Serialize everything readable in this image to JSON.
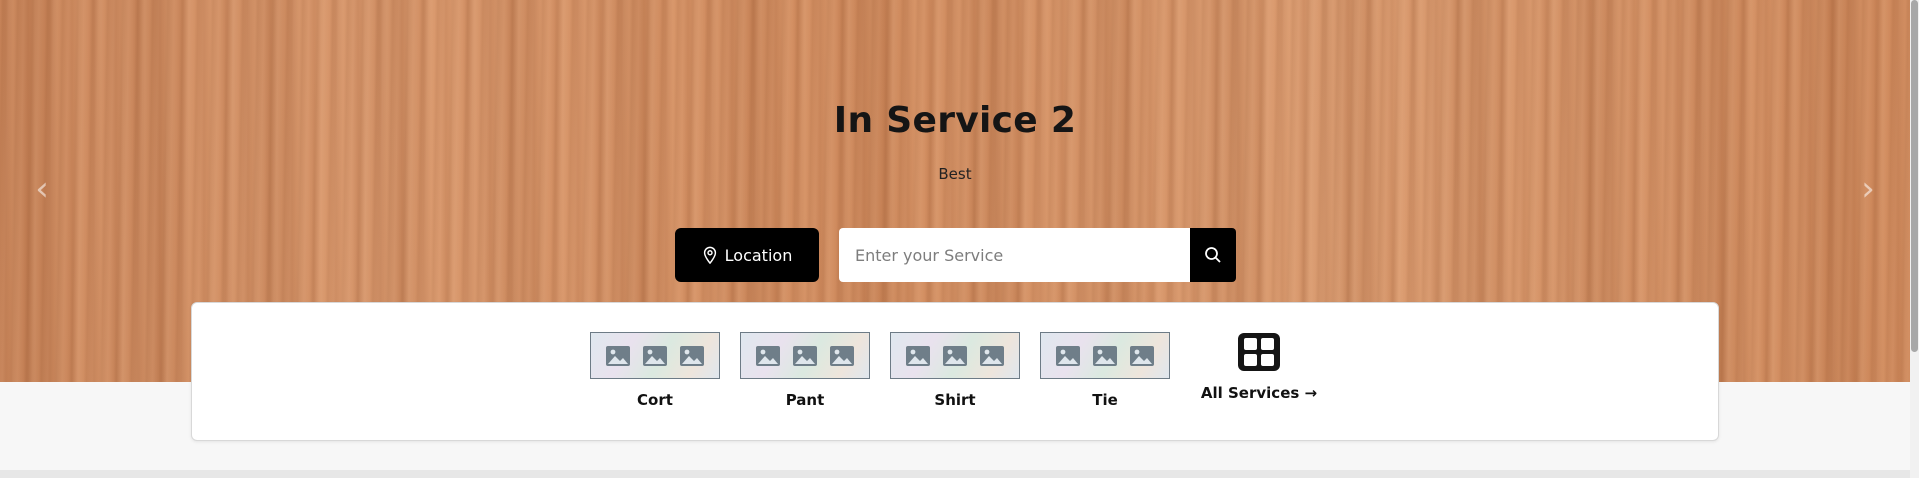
{
  "hero": {
    "title": "In Service 2",
    "subtitle": "Best",
    "prev_arrow": "‹",
    "next_arrow": "›"
  },
  "search": {
    "location_label": "Location",
    "location_icon": "map-pin-icon",
    "placeholder": "Enter your Service",
    "value": "",
    "search_icon": "search-icon"
  },
  "services": {
    "items": [
      {
        "label": "Cort",
        "icon": "image-placeholder-icon"
      },
      {
        "label": "Pant",
        "icon": "image-placeholder-icon"
      },
      {
        "label": "Shirt",
        "icon": "image-placeholder-icon"
      },
      {
        "label": "Tie",
        "icon": "image-placeholder-icon"
      }
    ],
    "all_label": "All Services →",
    "all_icon": "grid-icon"
  },
  "colors": {
    "accent": "#000000",
    "hero_wood": "#d38f64",
    "card_bg": "#ffffff"
  }
}
